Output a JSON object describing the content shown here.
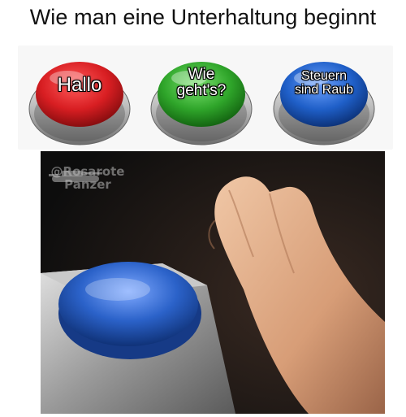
{
  "title": "Wie man eine Unterhaltung beginnt",
  "buttons": [
    {
      "label_line1": "Hallo",
      "label_line2": "",
      "color": "#d81e22"
    },
    {
      "label_line1": "Wie",
      "label_line2": "geht's?",
      "color": "#2fa52a"
    },
    {
      "label_line1": "Steuern",
      "label_line2": "sind Raub",
      "color": "#1f5fc8"
    }
  ],
  "photo": {
    "button_color": "#2b62c9",
    "watermark_line1": "@Rosarote",
    "watermark_line2": "Panzer",
    "watermark_icon": "tank-icon"
  }
}
